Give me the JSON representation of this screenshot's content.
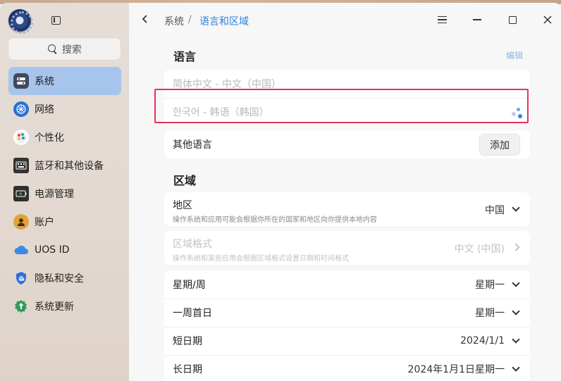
{
  "sidebar": {
    "search_label": "搜索",
    "items": [
      {
        "label": "系统",
        "icon": "system-icon",
        "color": "#3f4a5c"
      },
      {
        "label": "网络",
        "icon": "network-icon",
        "color": "#2a6fd6"
      },
      {
        "label": "个性化",
        "icon": "personalization-icon",
        "color": "#e48a3b"
      },
      {
        "label": "蓝牙和其他设备",
        "icon": "bluetooth-devices-icon",
        "color": "#333333"
      },
      {
        "label": "电源管理",
        "icon": "power-icon",
        "color": "#2f2f2f"
      },
      {
        "label": "账户",
        "icon": "account-icon",
        "color": "#e3a13a"
      },
      {
        "label": "UOS ID",
        "icon": "cloud-icon",
        "color": "#3b8ae8"
      },
      {
        "label": "隐私和安全",
        "icon": "privacy-shield-icon",
        "color": "#2c6de0"
      },
      {
        "label": "系统更新",
        "icon": "update-icon",
        "color": "#2e9c5a"
      }
    ]
  },
  "header": {
    "crumb_parent": "系统",
    "crumb_sep": "/",
    "crumb_current": "语言和区域"
  },
  "language": {
    "title": "语言",
    "edit_label": "编辑",
    "langs": [
      {
        "label": "简体中文 - 中文（中国）"
      },
      {
        "label": "한국어 - 韩语（韩国）"
      }
    ],
    "other_label": "其他语言",
    "add_label": "添加"
  },
  "region": {
    "title": "区域",
    "area_label": "地区",
    "area_desc": "操作系统和应用可能会根据你所在的国家和地区向你提供本地内容",
    "area_value": "中国",
    "format_label": "区域格式",
    "format_desc": "操作系统和某些应用会根据区域格式设置日期和时间格式",
    "format_value": "中文 (中国)",
    "rows": [
      {
        "label": "星期/周",
        "value": "星期一"
      },
      {
        "label": "一周首日",
        "value": "星期一"
      },
      {
        "label": "短日期",
        "value": "2024/1/1"
      },
      {
        "label": "长日期",
        "value": "2024年1月1日星期一"
      }
    ]
  },
  "colors": {
    "accent": "#2d82e0",
    "highlight": "#e8305a",
    "active_nav": "#a7c4ec"
  }
}
